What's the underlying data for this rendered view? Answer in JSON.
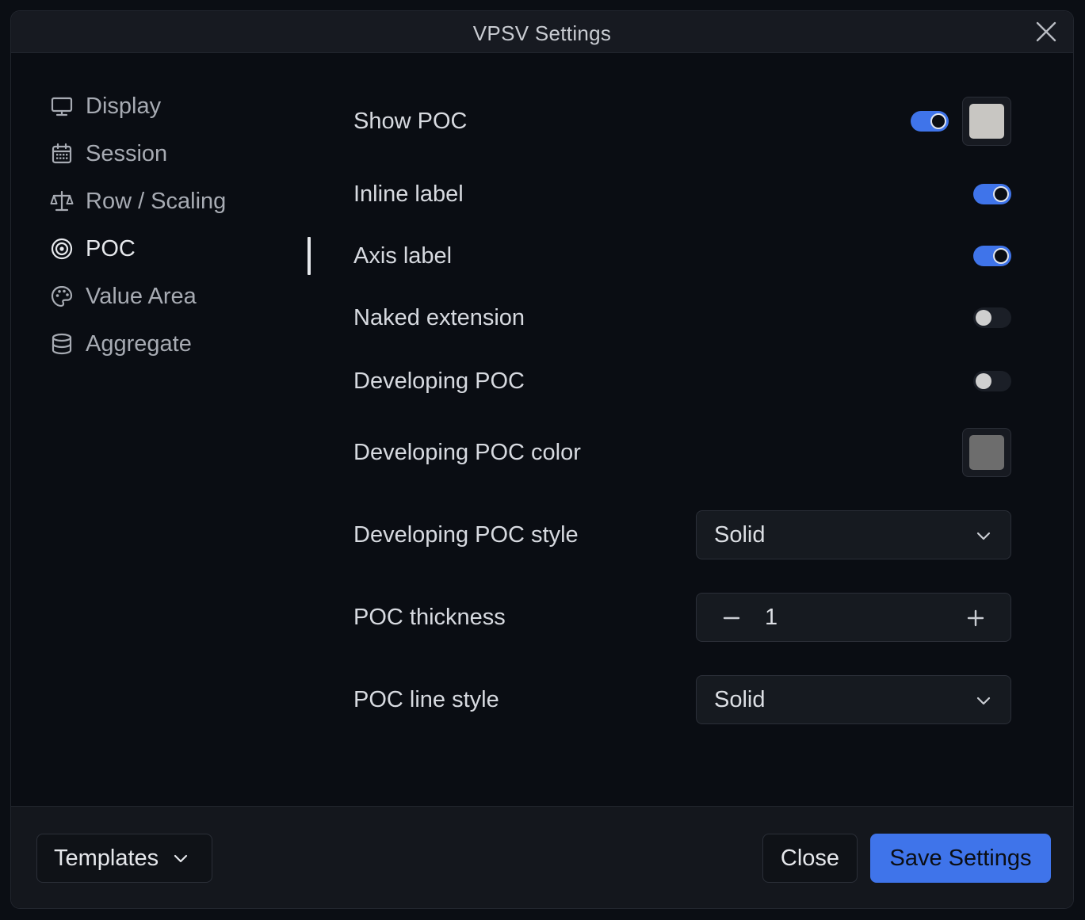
{
  "window": {
    "title": "VPSV Settings"
  },
  "sidebar": {
    "items": [
      {
        "label": "Display",
        "icon": "monitor-icon",
        "active": false
      },
      {
        "label": "Session",
        "icon": "calendar-icon",
        "active": false
      },
      {
        "label": "Row / Scaling",
        "icon": "scale-icon",
        "active": false
      },
      {
        "label": "POC",
        "icon": "target-icon",
        "active": true
      },
      {
        "label": "Value Area",
        "icon": "palette-icon",
        "active": false
      },
      {
        "label": "Aggregate",
        "icon": "database-icon",
        "active": false
      }
    ]
  },
  "settings": {
    "show_poc": {
      "label": "Show POC",
      "enabled": true,
      "color": "#c8c6c2"
    },
    "inline_label": {
      "label": "Inline label",
      "enabled": true
    },
    "axis_label": {
      "label": "Axis label",
      "enabled": true
    },
    "naked_extension": {
      "label": "Naked extension",
      "enabled": false
    },
    "developing_poc": {
      "label": "Developing POC",
      "enabled": false
    },
    "developing_poc_color": {
      "label": "Developing POC color",
      "color": "#6d6d6d"
    },
    "developing_poc_style": {
      "label": "Developing POC style",
      "value": "Solid"
    },
    "poc_thickness": {
      "label": "POC thickness",
      "value": "1"
    },
    "poc_line_style": {
      "label": "POC line style",
      "value": "Solid"
    }
  },
  "footer": {
    "templates_label": "Templates",
    "close_label": "Close",
    "save_label": "Save Settings"
  },
  "colors": {
    "accent": "#3f74ea"
  }
}
